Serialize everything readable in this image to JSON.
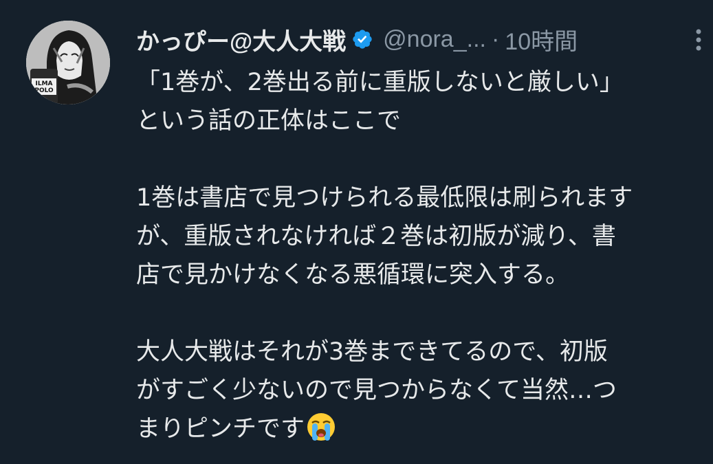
{
  "author": {
    "display_name": "かっぴー@大人大戦",
    "handle": "@nora_...",
    "separator": "·",
    "time": "10時間",
    "avatar_text": [
      "ILMA",
      "POLO"
    ]
  },
  "icons": {
    "verified": "verified-badge-icon",
    "more": "more-vertical-icon",
    "emoji": "loudly-crying-face-emoji"
  },
  "colors": {
    "background": "#15202b",
    "text": "#e7e9ea",
    "muted": "#8b98a5",
    "verified": "#1d9bf0"
  },
  "tweet": {
    "paragraph1": [
      "「1巻が、2巻出る前に重版しないと厳しい」",
      "という話の正体はここで"
    ],
    "paragraph2": [
      "1巻は書店で見つけられる最低限は刷られます",
      "が、重版されなければ２巻は初版が減り、書",
      "店で見かけなくなる悪循環に突入する。"
    ],
    "paragraph3": [
      "大人大戦はそれが3巻まできてるので、初版",
      "がすごく少ないので見つからなくて当然…つ",
      "まりピンチです"
    ]
  }
}
